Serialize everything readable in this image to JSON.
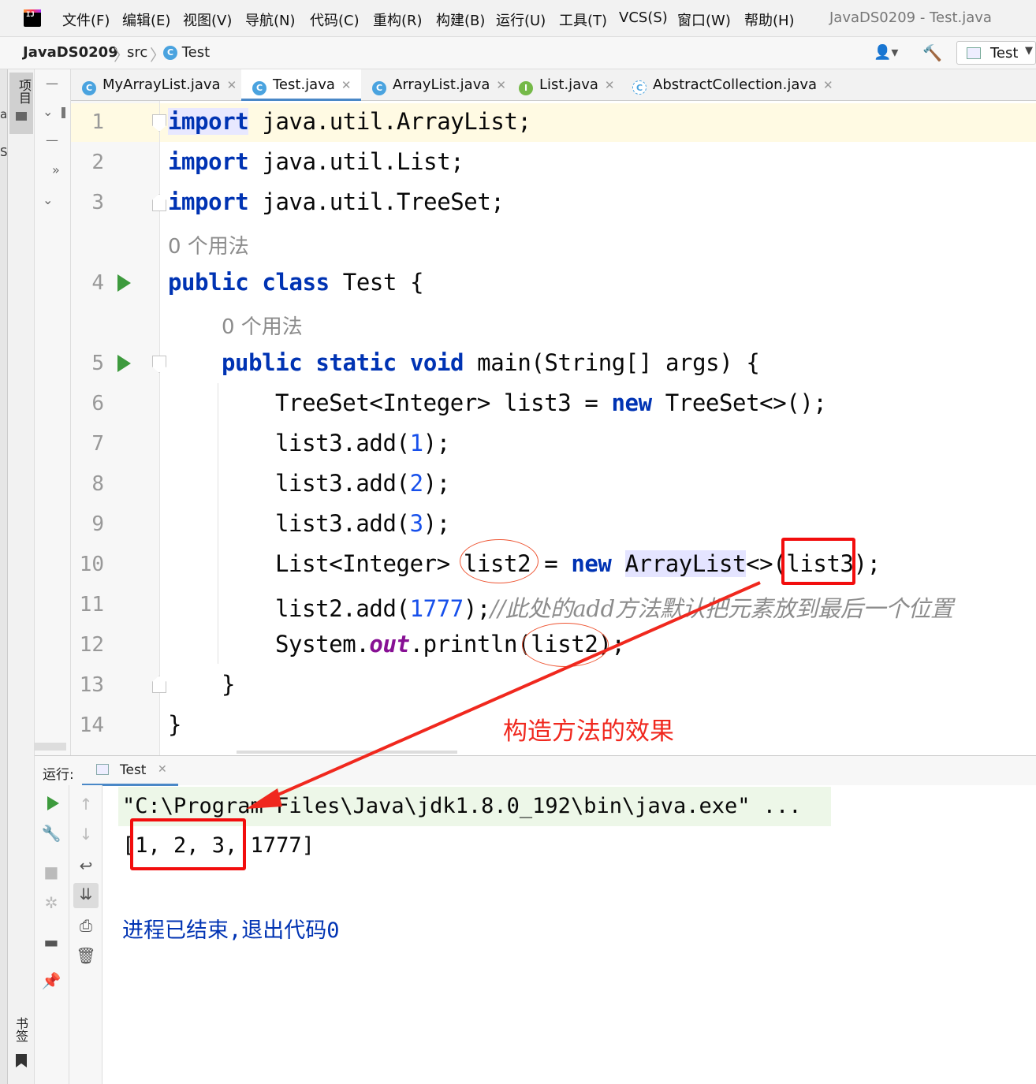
{
  "window": {
    "title": "JavaDS0209 - Test.java",
    "app_logo": "IJ"
  },
  "menu": [
    {
      "label": "文件(F)"
    },
    {
      "label": "编辑(E)"
    },
    {
      "label": "视图(V)"
    },
    {
      "label": "导航(N)"
    },
    {
      "label": "代码(C)"
    },
    {
      "label": "重构(R)"
    },
    {
      "label": "构建(B)"
    },
    {
      "label": "运行(U)"
    },
    {
      "label": "工具(T)"
    },
    {
      "label": "VCS(S)"
    },
    {
      "label": "窗口(W)"
    },
    {
      "label": "帮助(H)"
    }
  ],
  "breadcrumb": {
    "project": "JavaDS0209",
    "folder": "src",
    "file": "Test",
    "file_icon": "C"
  },
  "toolbar": {
    "run_config": "Test",
    "user_icon": "user-icon",
    "build_icon": "hammer-icon"
  },
  "left_stripe": {
    "project_tab": "项目",
    "bookmarks_tab": "书签"
  },
  "tabs": [
    {
      "label": "MyArrayList.java",
      "icon": "C",
      "active": false
    },
    {
      "label": "Test.java",
      "icon": "C",
      "active": true
    },
    {
      "label": "ArrayList.java",
      "icon": "C",
      "active": false
    },
    {
      "label": "List.java",
      "icon": "I",
      "active": false
    },
    {
      "label": "AbstractCollection.java",
      "icon": "C",
      "active": false
    }
  ],
  "editor": {
    "line_numbers": [
      "1",
      "2",
      "3",
      "4",
      "5",
      "6",
      "7",
      "8",
      "9",
      "10",
      "11",
      "12",
      "13",
      "14"
    ],
    "usage_hint": "0 个用法",
    "code": {
      "l1_kw": "import",
      "l1_rest": " java.util.ArrayList;",
      "l2_kw": "import",
      "l2_rest": " java.util.List;",
      "l3_kw": "import",
      "l3_rest": " java.util.TreeSet;",
      "l4_kw1": "public",
      "l4_kw2": "class",
      "l4_rest": " Test {",
      "l5_kw1": "public",
      "l5_kw2": "static",
      "l5_kw3": "void",
      "l5_rest": " main(String[] args) {",
      "l6_a": "TreeSet<Integer> list3 = ",
      "l6_kw": "new",
      "l6_b": " TreeSet<>();",
      "l7_a": "list3.add(",
      "l7_num": "1",
      "l7_b": ");",
      "l8_a": "list3.add(",
      "l8_num": "2",
      "l8_b": ");",
      "l9_a": "list3.add(",
      "l9_num": "3",
      "l9_b": ");",
      "l10_a": "List<Integer> list2 = ",
      "l10_kw": "new",
      "l10_sp": " ",
      "l10_cls": "ArrayList",
      "l10_b": "<>(list3);",
      "l11_a": "list2.add(",
      "l11_num": "1777",
      "l11_b": ");",
      "l11_cm": "//此处的add方法默认把元素放到最后一个位置",
      "l12_a": "System.",
      "l12_fld": "out",
      "l12_b": ".println(list2);",
      "l13": "}",
      "l14": "}"
    }
  },
  "run_panel": {
    "label": "运行:",
    "tab": "Test",
    "command": "\"C:\\Program Files\\Java\\jdk1.8.0_192\\bin\\java.exe\" ...",
    "output": "[1, 2, 3, 1777]",
    "exit": "进程已结束,退出代码0"
  },
  "annotation": {
    "text": "构造方法的效果",
    "color": "#f0281e"
  },
  "colors": {
    "keyword": "#0033b3",
    "number": "#1750eb",
    "comment": "#8c8c8c",
    "accent": "#4a88c7",
    "run": "#3d9a3d"
  }
}
